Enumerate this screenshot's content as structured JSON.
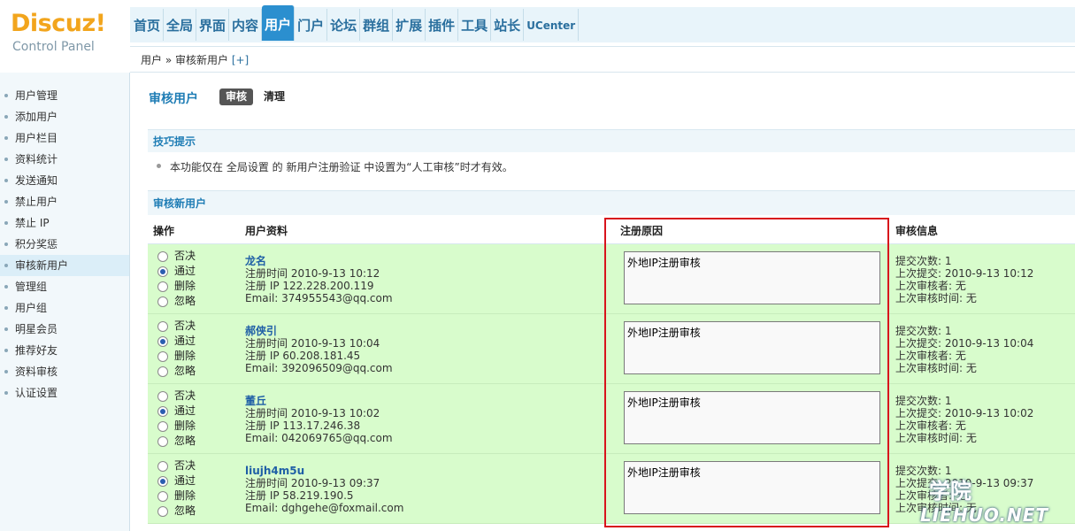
{
  "logo": {
    "main": "Discuz!",
    "sub": "Control Panel"
  },
  "topnav": [
    {
      "label": "首页",
      "active": false
    },
    {
      "label": "全局",
      "active": false
    },
    {
      "label": "界面",
      "active": false
    },
    {
      "label": "内容",
      "active": false
    },
    {
      "label": "用户",
      "active": true
    },
    {
      "label": "门户",
      "active": false
    },
    {
      "label": "论坛",
      "active": false
    },
    {
      "label": "群组",
      "active": false
    },
    {
      "label": "扩展",
      "active": false
    },
    {
      "label": "插件",
      "active": false
    },
    {
      "label": "工具",
      "active": false
    },
    {
      "label": "站长",
      "active": false
    },
    {
      "label": "UCenter",
      "active": false
    }
  ],
  "breadcrumb": {
    "path": "用户 » 审核新用户",
    "add": "[+]"
  },
  "sidebar": {
    "items": [
      {
        "label": "用户管理",
        "active": false
      },
      {
        "label": "添加用户",
        "active": false
      },
      {
        "label": "用户栏目",
        "active": false
      },
      {
        "label": "资料统计",
        "active": false
      },
      {
        "label": "发送通知",
        "active": false
      },
      {
        "label": "禁止用户",
        "active": false
      },
      {
        "label": "禁止 IP",
        "active": false
      },
      {
        "label": "积分奖惩",
        "active": false
      },
      {
        "label": "审核新用户",
        "active": true
      },
      {
        "label": "管理组",
        "active": false
      },
      {
        "label": "用户组",
        "active": false
      },
      {
        "label": "明星会员",
        "active": false
      },
      {
        "label": "推荐好友",
        "active": false
      },
      {
        "label": "资料审核",
        "active": false
      },
      {
        "label": "认证设置",
        "active": false
      }
    ]
  },
  "main": {
    "title": "审核用户",
    "tabs": {
      "audit": "审核",
      "clean": "清理"
    },
    "tips_label": "技巧提示",
    "tip": "本功能仅在 全局设置 的 新用户注册验证 中设置为“人工审核”时才有效。",
    "review_label": "审核新用户",
    "columns": {
      "op": "操作",
      "profile": "用户资料",
      "reason": "注册原因",
      "info": "审核信息"
    },
    "options": [
      "否决",
      "通过",
      "删除",
      "忽略"
    ],
    "rows": [
      {
        "name": "龙名",
        "regtime": "注册时间 2010-9-13 10:12",
        "regip": "注册 IP 122.228.200.119",
        "email": "Email: 374955543@qq.com",
        "reason": "外地IP注册审核",
        "count": "提交次数: 1",
        "last_submit": "上次提交: 2010-9-13 10:12",
        "last_reviewer": "上次审核者: 无",
        "last_time": "上次审核时间: 无",
        "selected": 1
      },
      {
        "name": "郝侠引",
        "regtime": "注册时间 2010-9-13 10:04",
        "regip": "注册 IP 60.208.181.45",
        "email": "Email: 392096509@qq.com",
        "reason": "外地IP注册审核",
        "count": "提交次数: 1",
        "last_submit": "上次提交: 2010-9-13 10:04",
        "last_reviewer": "上次审核者: 无",
        "last_time": "上次审核时间: 无",
        "selected": 1
      },
      {
        "name": "董丘",
        "regtime": "注册时间 2010-9-13 10:02",
        "regip": "注册 IP 113.17.246.38",
        "email": "Email: 042069765@qq.com",
        "reason": "外地IP注册审核",
        "count": "提交次数: 1",
        "last_submit": "上次提交: 2010-9-13 10:02",
        "last_reviewer": "上次审核者: 无",
        "last_time": "上次审核时间: 无",
        "selected": 1
      },
      {
        "name": "liujh4m5u",
        "regtime": "注册时间 2010-9-13 09:37",
        "regip": "注册 IP 58.219.190.5",
        "email": "Email: dghgehe@foxmail.com",
        "reason": "外地IP注册审核",
        "count": "提交次数: 1",
        "last_submit": "上次提交: 2010-9-13 09:37",
        "last_reviewer": "上次审核者: 无",
        "last_time": "上次审核时间: 无",
        "selected": 1
      }
    ]
  },
  "watermark": {
    "top": "学院",
    "bottom": "LIEHUO.NET"
  },
  "colors": {
    "accent": "#2b8fcf",
    "row_bg": "#d8fccc",
    "highlight": "#d8141c",
    "logo": "#f2a51d"
  }
}
